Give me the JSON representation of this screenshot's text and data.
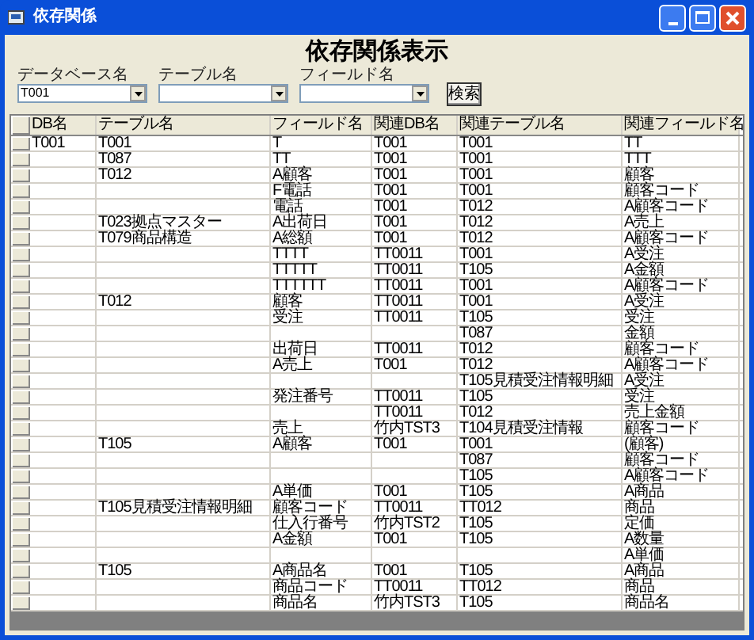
{
  "window": {
    "title": "依存関係"
  },
  "heading": "依存関係表示",
  "filters": [
    {
      "label": "データベース名",
      "value": "T001"
    },
    {
      "label": "テーブル名"
    },
    {
      "label": "フィールド名"
    }
  ],
  "search_button": "検索",
  "grid": {
    "columns": [
      "DB名",
      "テーブル名",
      "フィールド名",
      "関連DB名",
      "関連テーブル名",
      "関連フィールド名"
    ],
    "rows": [
      {
        "db": "T001",
        "table": "T001",
        "field": "T",
        "rel_db": "T001",
        "rel_table": "T001",
        "rel_field": "TT"
      },
      {
        "table": "T087",
        "field": "TT",
        "rel_db": "T001",
        "rel_table": "T001",
        "rel_field": "TTT"
      },
      {
        "table": "T012",
        "field": "A顧客",
        "rel_db": "T001",
        "rel_table": "T001",
        "rel_field": "顧客"
      },
      {
        "field": "F電話",
        "rel_db": "T001",
        "rel_table": "T001",
        "rel_field": "顧客コード"
      },
      {
        "field": "電話",
        "rel_db": "T001",
        "rel_table": "T012",
        "rel_field": "A顧客コード"
      },
      {
        "table": "T023拠点マスター",
        "field": "A出荷日",
        "rel_db": "T001",
        "rel_table": "T012",
        "rel_field": "A売上"
      },
      {
        "table": "T079商品構造",
        "field": "A総額",
        "rel_db": "T001",
        "rel_table": "T012",
        "rel_field": "A顧客コード"
      },
      {
        "field": "TTTT",
        "rel_db": "TT0011",
        "rel_table": "T001",
        "rel_field": "A受注"
      },
      {
        "field": "TTTTT",
        "rel_db": "TT0011",
        "rel_table": "T105",
        "rel_field": "A金額"
      },
      {
        "field": "TTTTTT",
        "rel_db": "TT0011",
        "rel_table": "T001",
        "rel_field": "A顧客コード"
      },
      {
        "table": "T012",
        "field": "顧客",
        "rel_db": "TT0011",
        "rel_table": "T001",
        "rel_field": "A受注"
      },
      {
        "field": "受注",
        "rel_db": "TT0011",
        "rel_table": "T105",
        "rel_field": "受注"
      },
      {
        "rel_table": "T087",
        "rel_field": "金額"
      },
      {
        "field": "出荷日",
        "rel_db": "TT0011",
        "rel_table": "T012",
        "rel_field": "顧客コード"
      },
      {
        "field": "A売上",
        "rel_db": "T001",
        "rel_table": "T012",
        "rel_field": "A顧客コード"
      },
      {
        "rel_table": "T105見積受注情報明細",
        "rel_field": "A受注"
      },
      {
        "field": "発注番号",
        "rel_db": "TT0011",
        "rel_table": "T105",
        "rel_field": "受注"
      },
      {
        "rel_db": "TT0011",
        "rel_table": "T012",
        "rel_field": "売上金額"
      },
      {
        "field": "売上",
        "rel_db": "竹内TST3",
        "rel_table": "T104見積受注情報",
        "rel_field": "顧客コード"
      },
      {
        "table": "T105",
        "field": "A顧客",
        "rel_db": "T001",
        "rel_table": "T001",
        "rel_field": "(顧客)"
      },
      {
        "rel_table": "T087",
        "rel_field": "顧客コード"
      },
      {
        "rel_table": "T105",
        "rel_field": "A顧客コード"
      },
      {
        "field": "A単価",
        "rel_db": "T001",
        "rel_table": "T105",
        "rel_field": "A商品"
      },
      {
        "table": "T105見積受注情報明細",
        "field": "顧客コード",
        "rel_db": "TT0011",
        "rel_table": "TT012",
        "rel_field": "商品"
      },
      {
        "field": "仕入行番号",
        "rel_db": "竹内TST2",
        "rel_table": "T105",
        "rel_field": "定価"
      },
      {
        "field": "A金額",
        "rel_db": "T001",
        "rel_table": "T105",
        "rel_field": "A数量"
      },
      {
        "rel_field": "A単価"
      },
      {
        "table": "T105",
        "field": "A商品名",
        "rel_db": "T001",
        "rel_table": "T105",
        "rel_field": "A商品"
      },
      {
        "field": "商品コード",
        "rel_db": "TT0011",
        "rel_table": "TT012",
        "rel_field": "商品"
      },
      {
        "field": "商品名",
        "rel_db": "竹内TST3",
        "rel_table": "T105",
        "rel_field": "商品名"
      }
    ]
  }
}
